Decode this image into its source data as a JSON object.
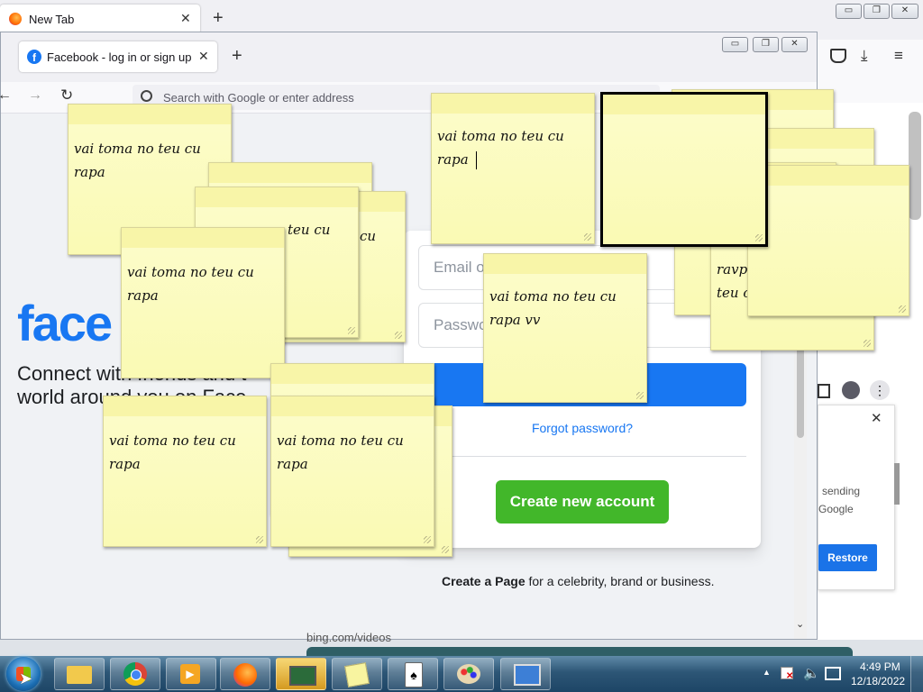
{
  "outer_window": {
    "tab_title": "New Tab",
    "new_tab_symbol": "+",
    "controls": {
      "minimize": "▭",
      "restore": "❐",
      "close": "✕"
    }
  },
  "inner_window": {
    "tab_title": "Facebook - log in or sign up",
    "new_tab_symbol": "+",
    "url_placeholder": "Search with Google or enter address",
    "controls": {
      "minimize": "▭",
      "restore": "❐",
      "close": "✕"
    }
  },
  "facebook": {
    "logo_partial": "face",
    "tagline_line1": "Connect with friends and t",
    "tagline_line2": "world around you on Face",
    "email_placeholder": "Email o",
    "password_placeholder": "Passwo",
    "forgot_password": "Forgot password?",
    "create_account": "Create new account",
    "create_page_bold": "Create a Page",
    "create_page_rest": " for a celebrity, brand or business."
  },
  "right_panel": {
    "text_line1": "sending",
    "text_line2": "Google",
    "restore_button": "Restore",
    "close_symbol": "✕"
  },
  "background_link": "bing.com/videos",
  "sticky_notes": [
    {
      "id": "n1",
      "text": "vai toma no teu cu\nrapa"
    },
    {
      "id": "n2",
      "text": ""
    },
    {
      "id": "n3",
      "text": "teu cu"
    },
    {
      "id": "n4",
      "text": "cu"
    },
    {
      "id": "n5",
      "text": "vai toma no teu cu\nrapa"
    },
    {
      "id": "n6",
      "text": "vai toma no teu cu\nrapa"
    },
    {
      "id": "n7",
      "text": ""
    },
    {
      "id": "n8",
      "text": "vai toma no teu cu\nrapa vv"
    },
    {
      "id": "n9",
      "text": "ravp\nteu c"
    },
    {
      "id": "n10",
      "text": "vai toma no teu cu\nrapa"
    },
    {
      "id": "n11",
      "text": "vai toma no teu cu\nrapa"
    }
  ],
  "taskbar": {
    "clock_time": "4:49 PM",
    "clock_date": "12/18/2022",
    "tray_up_arrow": "▲"
  },
  "colors": {
    "facebook_blue": "#1877f2",
    "green_button": "#42b72a",
    "sticky_yellow": "#fcfcc8"
  }
}
